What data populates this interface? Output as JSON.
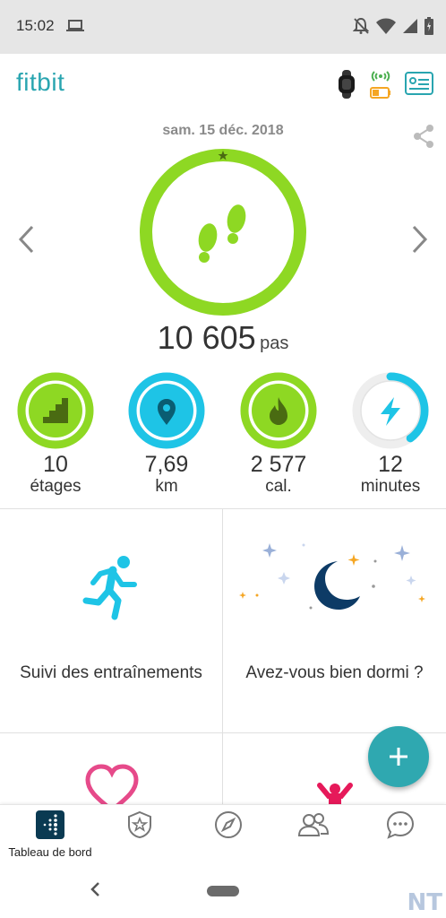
{
  "status_bar": {
    "time": "15:02"
  },
  "header": {
    "logo": "fitbit"
  },
  "date": "sam. 15 déc. 2018",
  "steps": {
    "value": "10 605",
    "unit": "pas",
    "goal_progress": 1.0
  },
  "stats": [
    {
      "value": "10",
      "label": "étages",
      "progress": 1.0,
      "color": "#8ed823",
      "icon": "stairs-icon"
    },
    {
      "value": "7,69",
      "label": "km",
      "progress": 1.0,
      "color": "#1ec4e6",
      "icon": "location-pin-icon"
    },
    {
      "value": "2 577",
      "label": "cal.",
      "progress": 1.0,
      "color": "#8ed823",
      "icon": "flame-icon"
    },
    {
      "value": "12",
      "label": "minutes",
      "progress": 0.4,
      "color": "#1ec4e6",
      "icon": "lightning-icon"
    }
  ],
  "tiles": [
    {
      "label": "Suivi des entraînements",
      "icon": "running-person-icon"
    },
    {
      "label": "Avez-vous bien dormi ?",
      "icon": "moon-icon"
    },
    {
      "label": "",
      "icon": "heart-icon"
    },
    {
      "label": "",
      "icon": "person-cheering-icon"
    }
  ],
  "bottom_nav": {
    "dashboard_label": "Tableau de bord"
  },
  "colors": {
    "accent": "#2fa8b0",
    "green": "#8ed823",
    "blue": "#1ec4e6",
    "navy": "#0d3b66"
  },
  "watermark": "NT"
}
